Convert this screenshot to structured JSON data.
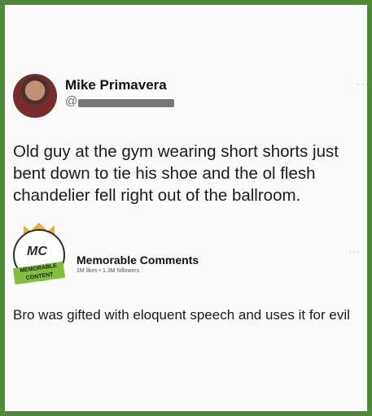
{
  "tweet": {
    "author_name": "Mike Primavera",
    "handle_prefix": "@",
    "more_label": "···",
    "text": "Old guy at the gym wearing short shorts just bent down to tie his shoe and the ol flesh chandelier fell right out of the ballroom."
  },
  "comment": {
    "logo_text": "MC",
    "logo_ribbon": "MEMORABLE CONTENT",
    "author_name": "Memorable Comments",
    "meta": "1M likes • 1.3M followers",
    "more_label": "···",
    "text": "Bro was gifted with eloquent speech and uses it for evil"
  },
  "colors": {
    "frame": "#4e8a3a",
    "background": "#fbfbfb",
    "crown": "#e4b236",
    "ribbon": "#7fbf3b"
  }
}
